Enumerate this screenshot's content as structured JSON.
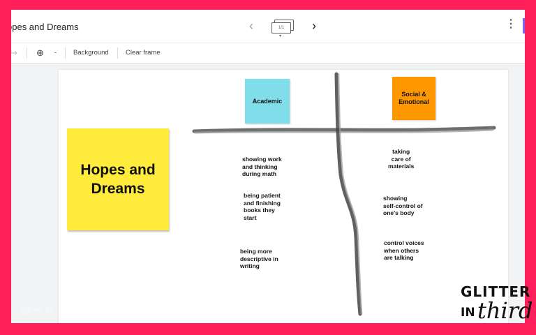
{
  "app": {
    "title": "opes and Dreams",
    "frame_indicator": "1/1",
    "prev_glyph": "‹",
    "next_glyph": "›",
    "more_glyph": "⋮"
  },
  "toolbar": {
    "redo_glyph": "↪",
    "zoom_glyph": "⊕",
    "zoom_dropdown": "-",
    "background_label": "Background",
    "clear_frame_label": "Clear frame"
  },
  "board": {
    "main_sticky": "Hopes and Dreams",
    "col_academic": "Academic",
    "col_social": "Social & Emotional",
    "academic_notes": [
      "showing work\nand thinking\nduring math",
      "being patient\nand finishing\nbooks they\nstart",
      "being more\ndescriptive in\nwriting"
    ],
    "social_notes": [
      "taking\ncare of\nmaterials",
      "showing\nself-control of\none's body",
      "control voices\nwhen others\nare talking"
    ],
    "colors": {
      "main_sticky": "#ffeb3b",
      "academic_sticky": "#80deea",
      "social_sticky": "#ff9800",
      "frame_border": "#ff1f5a"
    }
  },
  "footer": {
    "watermark_text": "Glitter in",
    "logo_line1": "GLITTER",
    "logo_line2": "IN",
    "logo_line3": "third"
  }
}
